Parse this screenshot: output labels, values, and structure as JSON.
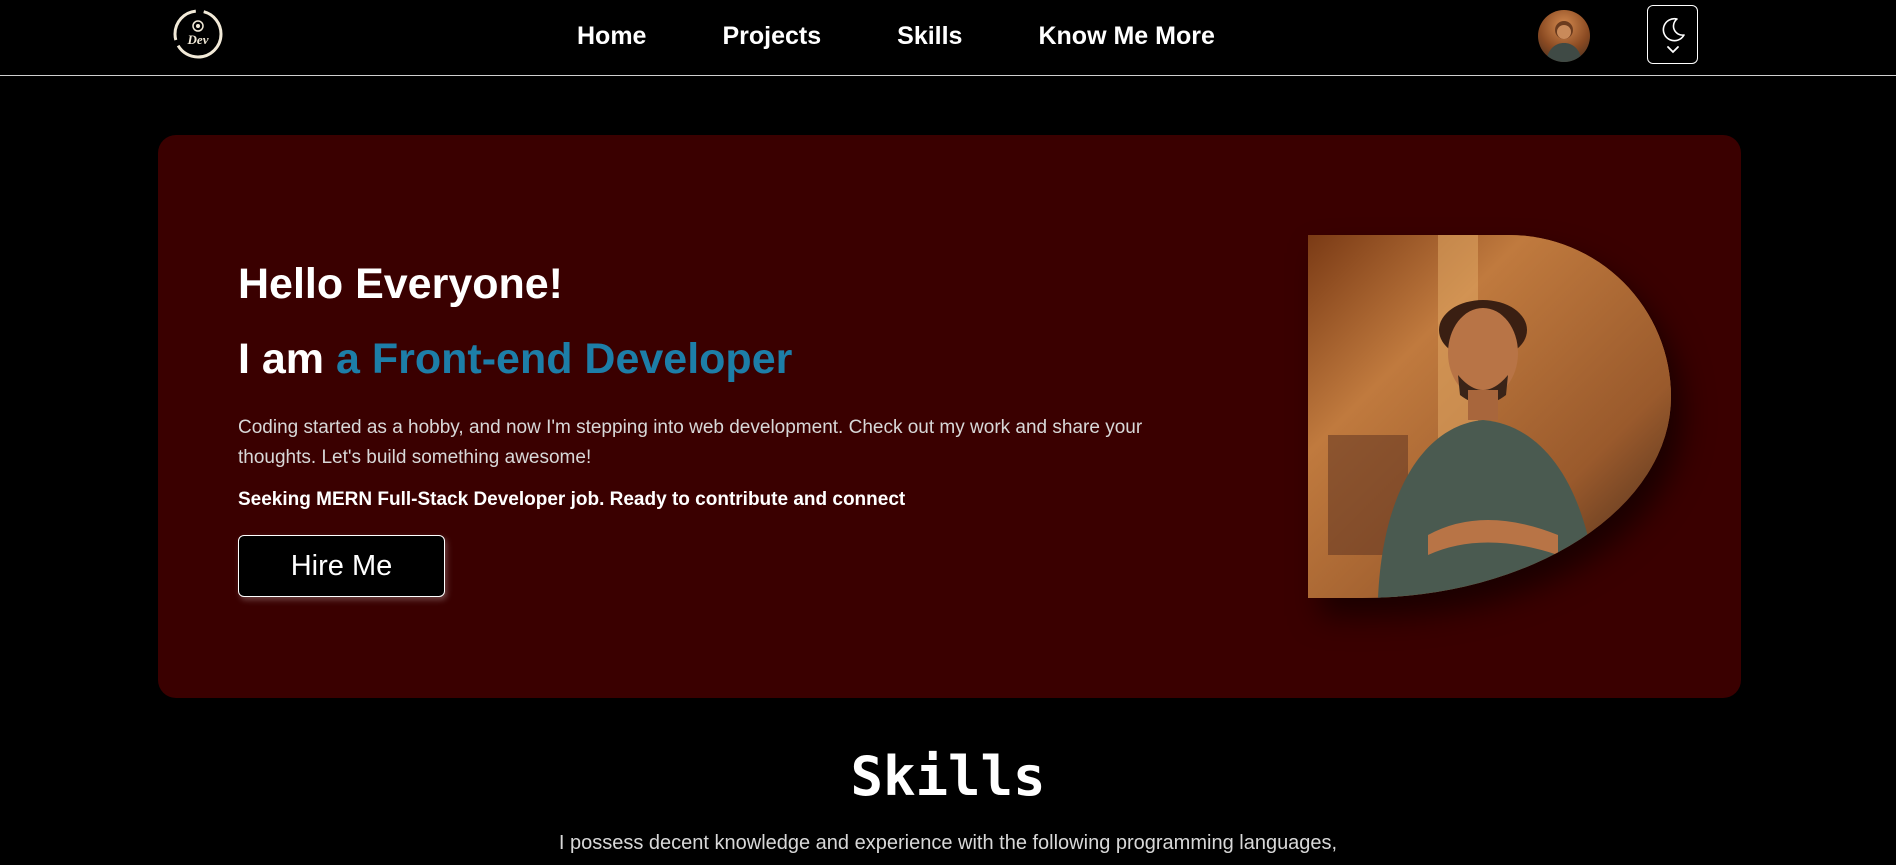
{
  "header": {
    "logo_text": "Dev",
    "nav": [
      "Home",
      "Projects",
      "Skills",
      "Know Me More"
    ]
  },
  "hero": {
    "greeting": "Hello Everyone!",
    "role_prefix": "I am ",
    "role_highlight": "a Front-end Developer",
    "bio": "Coding started as a hobby, and now I'm stepping into web development. Check out my work and share your thoughts. Let's build something awesome!",
    "seeking": "Seeking MERN Full-Stack Developer job. Ready to contribute and connect",
    "hire_button": "Hire Me"
  },
  "skills": {
    "title": "Skills",
    "description": "I possess decent knowledge and experience with the following programming languages,"
  },
  "colors": {
    "hero_background": "#3a0000",
    "accent": "#1d7ea8",
    "page_background": "#000000"
  },
  "icons": {
    "theme_toggle": "moon-icon",
    "theme_dropdown": "chevron-down-icon"
  }
}
